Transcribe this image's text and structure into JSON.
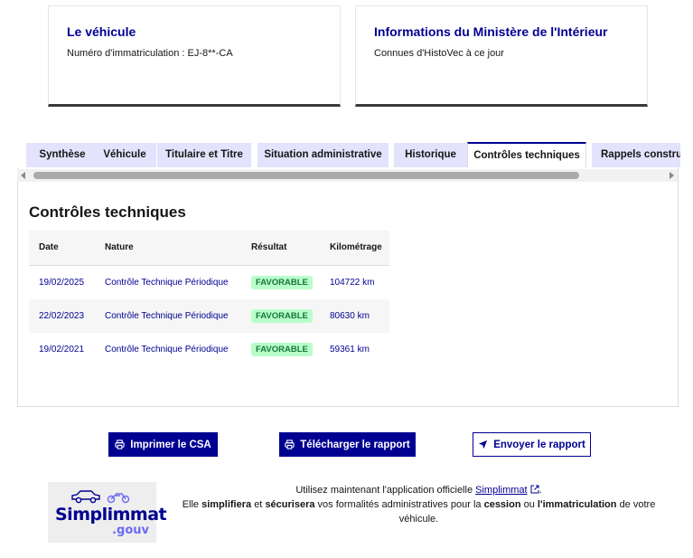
{
  "cards": {
    "vehicle": {
      "title": "Le véhicule",
      "plate": "Numéro d'immatriculation : EJ-8**-CA"
    },
    "ministry": {
      "title": "Informations du Ministère de l'Intérieur",
      "subtitle": "Connues d'HistoVec à ce jour"
    }
  },
  "tabs": [
    {
      "label": "Synthèse",
      "active": false
    },
    {
      "label": "Véhicule",
      "active": false
    },
    {
      "label": "Titulaire et Titre",
      "active": false
    },
    {
      "label": "Situation administrative",
      "active": false
    },
    {
      "label": "Historique",
      "active": false
    },
    {
      "label": "Contrôles techniques",
      "active": true
    },
    {
      "label": "Rappels constructeur",
      "active": false
    }
  ],
  "controls": {
    "title": "Contrôles techniques",
    "columns": [
      "Date",
      "Nature",
      "Résultat",
      "Kilométrage"
    ],
    "rows": [
      {
        "date": "19/02/2025",
        "nature": "Contrôle Technique Périodique",
        "result": "FAVORABLE",
        "km": "104722 km"
      },
      {
        "date": "22/02/2023",
        "nature": "Contrôle Technique Périodique",
        "result": "FAVORABLE",
        "km": "80630 km"
      },
      {
        "date": "19/02/2021",
        "nature": "Contrôle Technique Périodique",
        "result": "FAVORABLE",
        "km": "59361 km"
      }
    ]
  },
  "actions": {
    "print": "Imprimer le CSA",
    "download": "Télécharger le rapport",
    "send": "Envoyer le rapport"
  },
  "promo": {
    "logo_brand": "Simplimmat",
    "logo_suffix": ".gouv",
    "line1_prefix": "Utilisez maintenant l'application officielle",
    "link": "Simplimmat",
    "line1_suffix": ".",
    "line2_a": "Elle",
    "line2_b": "simplifiera",
    "line2_c": "et",
    "line2_d": "sécurisera",
    "line2_e": "vos formalités administratives pour la",
    "line2_f": "cession",
    "line2_g": "ou",
    "line2_h": "l'immatriculation",
    "line2_i": "de votre véhicule."
  },
  "colors": {
    "primary": "#000091",
    "tab_bg": "#e3e3fd",
    "badge_bg": "#b8fec9",
    "badge_text": "#18753c"
  }
}
